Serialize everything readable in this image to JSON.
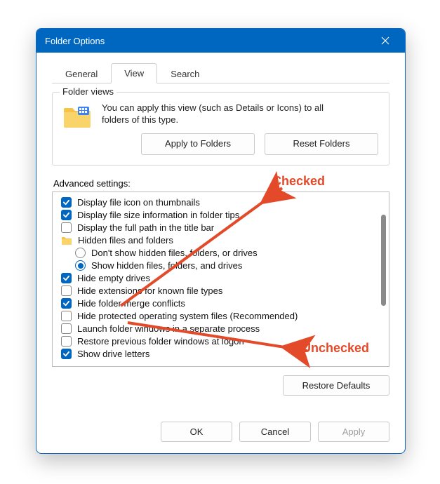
{
  "window": {
    "title": "Folder Options"
  },
  "tabs": {
    "general": "General",
    "view": "View",
    "search": "Search",
    "active": "view"
  },
  "folder_views": {
    "legend": "Folder views",
    "text_line1": "You can apply this view (such as Details or Icons) to all",
    "text_line2": "folders of this type.",
    "apply_btn": "Apply to Folders",
    "reset_btn": "Reset Folders"
  },
  "advanced": {
    "label": "Advanced settings:",
    "items": [
      {
        "type": "checkbox",
        "checked": true,
        "label": "Display file icon on thumbnails"
      },
      {
        "type": "checkbox",
        "checked": true,
        "label": "Display file size information in folder tips"
      },
      {
        "type": "checkbox",
        "checked": false,
        "label": "Display the full path in the title bar"
      },
      {
        "type": "folder",
        "label": "Hidden files and folders"
      },
      {
        "type": "radio",
        "checked": false,
        "label": "Don't show hidden files, folders, or drives",
        "indent": 1
      },
      {
        "type": "radio",
        "checked": true,
        "label": "Show hidden files, folders, and drives",
        "indent": 1
      },
      {
        "type": "checkbox",
        "checked": true,
        "label": "Hide empty drives"
      },
      {
        "type": "checkbox",
        "checked": false,
        "label": "Hide extensions for known file types"
      },
      {
        "type": "checkbox",
        "checked": true,
        "label": "Hide folder merge conflicts"
      },
      {
        "type": "checkbox",
        "checked": false,
        "label": "Hide protected operating system files (Recommended)"
      },
      {
        "type": "checkbox",
        "checked": false,
        "label": "Launch folder windows in a separate process"
      },
      {
        "type": "checkbox",
        "checked": false,
        "label": "Restore previous folder windows at logon"
      },
      {
        "type": "checkbox",
        "checked": true,
        "label": "Show drive letters"
      }
    ]
  },
  "restore_defaults_btn": "Restore Defaults",
  "footer": {
    "ok": "OK",
    "cancel": "Cancel",
    "apply": "Apply"
  },
  "annotations": {
    "checked": "Checked",
    "unchecked": "Unchecked"
  }
}
